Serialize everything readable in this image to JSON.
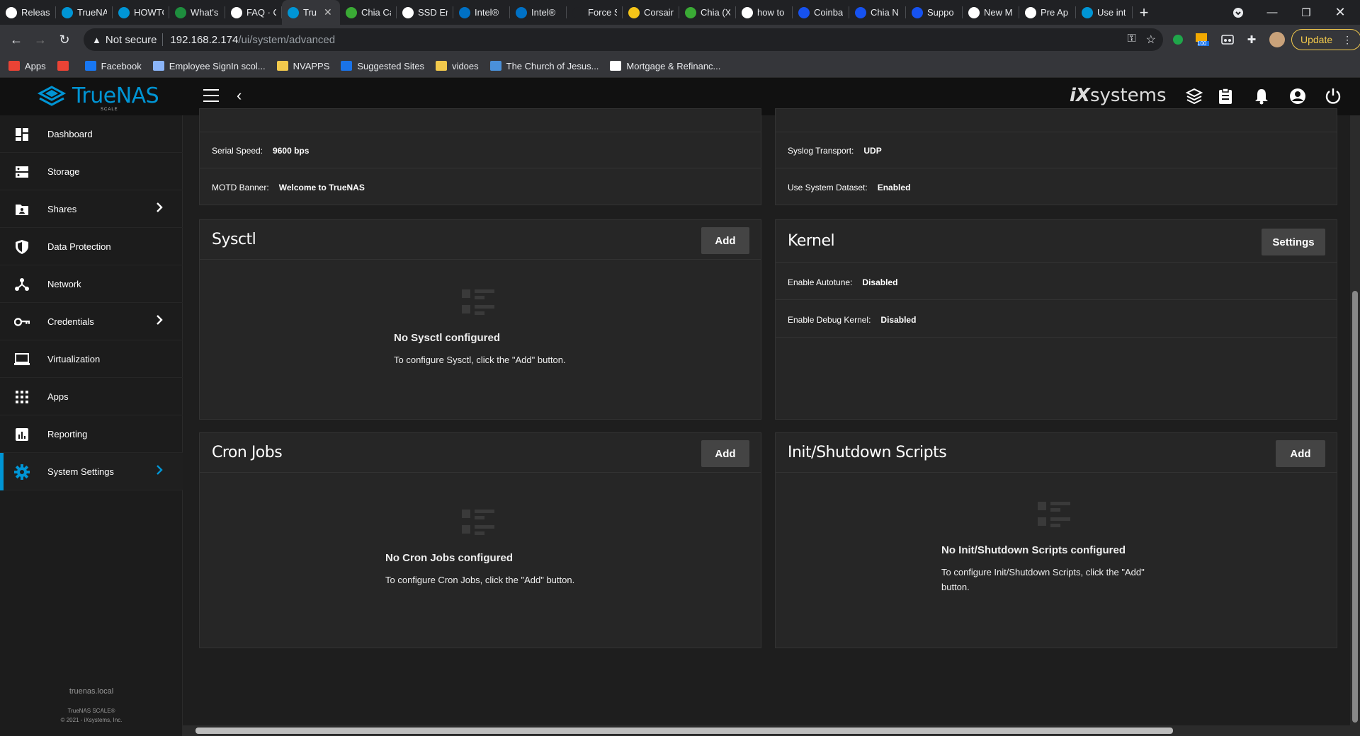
{
  "browser": {
    "tabs": [
      {
        "label": "Release",
        "color": "#ffffff"
      },
      {
        "label": "TrueNA",
        "color": "#0095d5"
      },
      {
        "label": "HOWTO",
        "color": "#0095d5"
      },
      {
        "label": "What's",
        "color": "#1e8e3e"
      },
      {
        "label": "FAQ · C",
        "color": "#ffffff"
      },
      {
        "label": "Tru",
        "color": "#0095d5",
        "active": true
      },
      {
        "label": "Chia Ca",
        "color": "#3aaa35"
      },
      {
        "label": "SSD En",
        "color": "#ffffff"
      },
      {
        "label": "Intel®",
        "color": "#0071c5"
      },
      {
        "label": "Intel®",
        "color": "#0071c5"
      },
      {
        "label": "Force S",
        "color": "#202124"
      },
      {
        "label": "Corsair",
        "color": "#f5c518"
      },
      {
        "label": "Chia (X",
        "color": "#3aaa35"
      },
      {
        "label": "how to",
        "color": "#ffffff"
      },
      {
        "label": "Coinba",
        "color": "#1652f0"
      },
      {
        "label": "Chia N",
        "color": "#1652f0"
      },
      {
        "label": "Suppo",
        "color": "#1652f0"
      },
      {
        "label": "New M",
        "color": "#ffffff"
      },
      {
        "label": "Pre Ap",
        "color": "#ffffff"
      },
      {
        "label": "Use int",
        "color": "#0095d5"
      }
    ],
    "close_glyph": "✕",
    "address": {
      "warning": "Not secure",
      "host": "192.168.2.174",
      "path": "/ui/system/advanced"
    },
    "update_label": "Update",
    "ext_badge": "100",
    "bookmarks": [
      {
        "label": "Apps",
        "color": "#ea4335"
      },
      {
        "label": "",
        "color": "#ea4335"
      },
      {
        "label": "Facebook",
        "color": "#1877f2"
      },
      {
        "label": "Employee SignIn scol...",
        "color": "#8ab4f8"
      },
      {
        "label": "NVAPPS",
        "color": "#f2c94c"
      },
      {
        "label": "Suggested Sites",
        "color": "#1a73e8"
      },
      {
        "label": "vidoes",
        "color": "#f2c94c"
      },
      {
        "label": "The Church of Jesus...",
        "color": "#4a90d9"
      },
      {
        "label": "Mortgage & Refinanc...",
        "color": "#ffffff"
      }
    ]
  },
  "app": {
    "brand": "TrueNAS",
    "brand_sub": "SCALE",
    "vendor": {
      "prefix": "iX",
      "suffix": "systems"
    }
  },
  "sidebar": {
    "items": [
      {
        "label": "Dashboard",
        "icon": "dashboard-icon"
      },
      {
        "label": "Storage",
        "icon": "storage-icon"
      },
      {
        "label": "Shares",
        "icon": "shares-icon",
        "chevron": true
      },
      {
        "label": "Data Protection",
        "icon": "shield-icon"
      },
      {
        "label": "Network",
        "icon": "network-icon"
      },
      {
        "label": "Credentials",
        "icon": "key-icon",
        "chevron": true
      },
      {
        "label": "Virtualization",
        "icon": "monitor-icon"
      },
      {
        "label": "Apps",
        "icon": "apps-grid-icon"
      },
      {
        "label": "Reporting",
        "icon": "chart-icon"
      },
      {
        "label": "System Settings",
        "icon": "gear-icon",
        "chevron": true,
        "active": true
      }
    ],
    "hostname": "truenas.local",
    "version": "TrueNAS SCALE®",
    "copyright": "© 2021 - iXsystems, Inc."
  },
  "console_card": {
    "rows": [
      {
        "label": "Serial Speed:",
        "value": "9600 bps"
      },
      {
        "label": "MOTD Banner:",
        "value": "Welcome to TrueNAS"
      }
    ]
  },
  "syslog_card": {
    "rows": [
      {
        "label": "Syslog Transport:",
        "value": "UDP"
      },
      {
        "label": "Use System Dataset:",
        "value": "Enabled"
      }
    ]
  },
  "sysctl_card": {
    "title": "Sysctl",
    "button": "Add",
    "empty_title": "No Sysctl configured",
    "empty_desc": "To configure Sysctl, click the \"Add\" button."
  },
  "kernel_card": {
    "title": "Kernel",
    "button": "Settings",
    "rows": [
      {
        "label": "Enable Autotune:",
        "value": "Disabled"
      },
      {
        "label": "Enable Debug Kernel:",
        "value": "Disabled"
      }
    ]
  },
  "cron_card": {
    "title": "Cron Jobs",
    "button": "Add",
    "empty_title": "No Cron Jobs configured",
    "empty_desc": "To configure Cron Jobs, click the \"Add\" button."
  },
  "init_card": {
    "title": "Init/Shutdown Scripts",
    "button": "Add",
    "empty_title": "No Init/Shutdown Scripts configured",
    "empty_desc": "To configure Init/Shutdown Scripts, click the \"Add\" button."
  }
}
